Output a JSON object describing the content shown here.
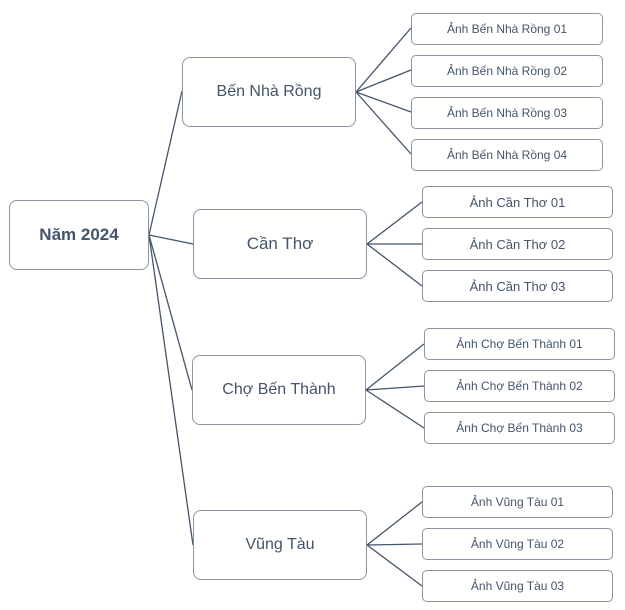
{
  "diagram": {
    "type": "mind-map",
    "root": {
      "label": "Năm 2024"
    },
    "branches": [
      {
        "label": "Bến Nhà Rồng",
        "children": [
          "Ảnh Bến Nhà Rồng 01",
          "Ảnh Bến Nhà Rồng 02",
          "Ảnh Bến Nhà Rồng 03",
          "Ảnh Bến Nhà Rồng 04"
        ]
      },
      {
        "label": "Cần Thơ",
        "children": [
          "Ảnh Cần Thơ 01",
          "Ảnh Cần Thơ 02",
          "Ảnh Cần Thơ 03"
        ]
      },
      {
        "label": "Chợ Bến Thành",
        "children": [
          "Ảnh Chợ Bến Thành 01",
          "Ảnh Chợ Bến Thành 02",
          "Ảnh Chợ Bến Thành 03"
        ]
      },
      {
        "label": "Vũng Tàu",
        "children": [
          "Ảnh Vũng Tàu 01",
          "Ảnh Vũng Tàu 02",
          "Ảnh Vũng Tàu 03"
        ]
      }
    ]
  },
  "colors": {
    "text": "#44546a",
    "border": "#8a94a3",
    "connector": "#44546a",
    "background": "#ffffff"
  }
}
